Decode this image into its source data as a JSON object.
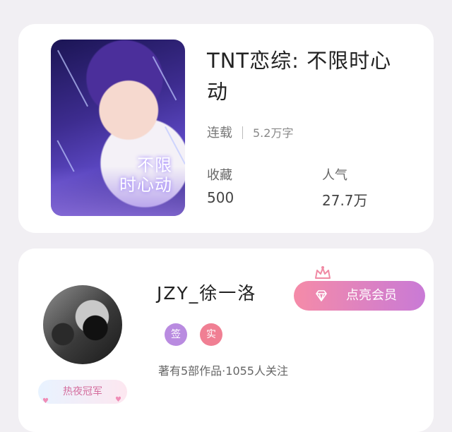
{
  "book": {
    "cover_text": "不限\n时心动",
    "title": "TNT恋综: 不限时心动",
    "status": "连载",
    "word_count": "5.2万字",
    "favorites_label": "收藏",
    "favorites_value": "500",
    "popularity_label": "人气",
    "popularity_value": "27.7万"
  },
  "author": {
    "name": "JZY_徐一洛",
    "vip_button_label": "点亮会员",
    "tag_sign": "签",
    "tag_real": "实",
    "stats": "著有5部作品·1055人关注",
    "badge": "热夜冠军"
  },
  "colors": {
    "vip_gradient_start": "#f58ba8",
    "vip_gradient_end": "#c97ad6",
    "tag_sign_bg": "#b98be0",
    "tag_real_bg": "#f07f93"
  },
  "icons": [
    "crown-icon",
    "diamond-icon"
  ]
}
